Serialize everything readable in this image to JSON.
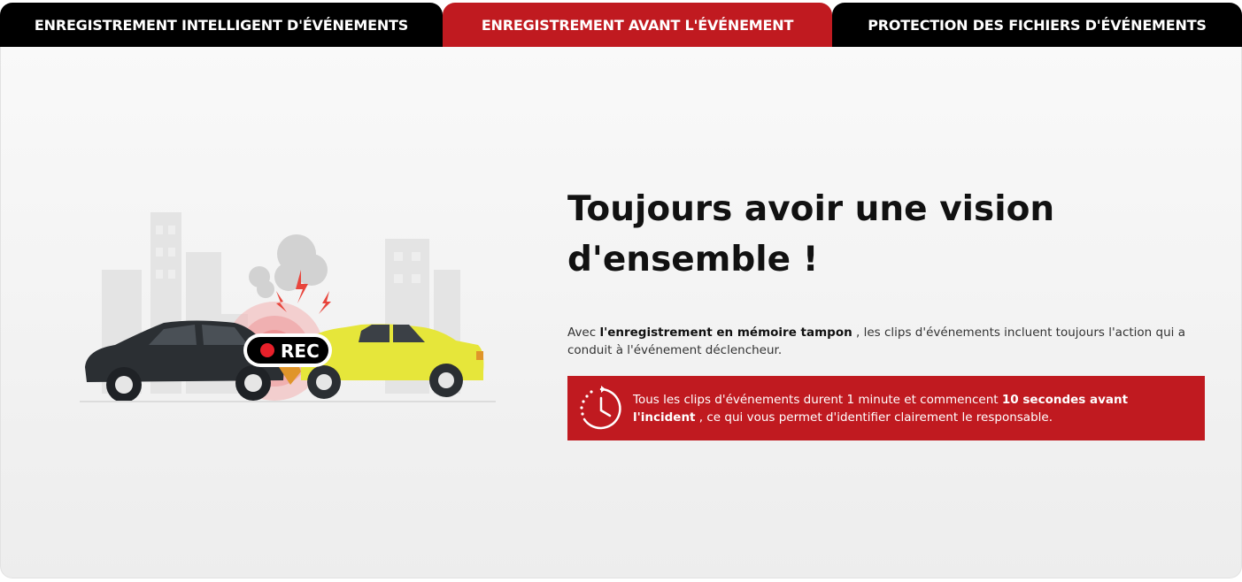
{
  "tabs": [
    {
      "label": "ENREGISTREMENT INTELLIGENT D'ÉVÉNEMENTS",
      "active": false
    },
    {
      "label": "ENREGISTREMENT AVANT L'ÉVÉNEMENT",
      "active": true
    },
    {
      "label": "PROTECTION DES FICHIERS D'ÉVÉNEMENTS",
      "active": false
    }
  ],
  "illustration": {
    "rec_label": "REC"
  },
  "content": {
    "headline_line1": "Toujours avoir une vision",
    "headline_line2": "d'ensemble !",
    "body_prefix": "Avec ",
    "body_bold": "l'enregistrement en mémoire tampon",
    "body_suffix": " , les clips d'événements incluent toujours l'action qui a conduit à l'événement déclencheur.",
    "callout_prefix": "Tous les clips d'événements durent 1 minute et commencent ",
    "callout_bold": "10 secondes avant l'incident",
    "callout_suffix": " , ce qui vous permet d'identifier clairement le responsable."
  },
  "colors": {
    "accent_red": "#c01a20",
    "tab_black": "#000000",
    "yellow_car": "#e6e63a",
    "dark_car": "#2b2f33"
  }
}
